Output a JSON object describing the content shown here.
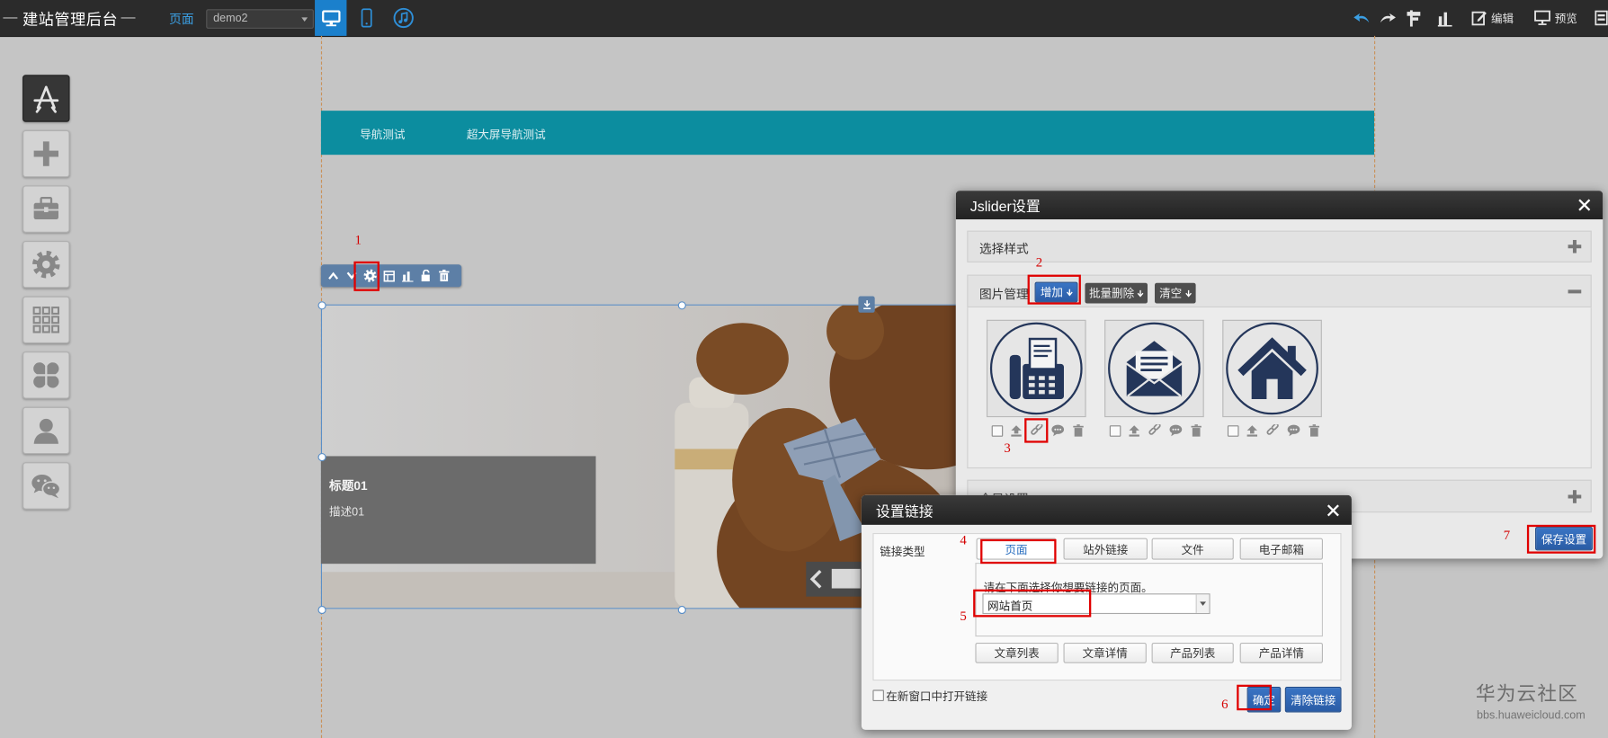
{
  "app": {
    "title": "建站管理后台"
  },
  "topbar": {
    "page_label": "页面",
    "page_select": "demo2",
    "edit_label": "编辑",
    "preview_label": "预览"
  },
  "left_toolbar": {
    "items": [
      {
        "icon": "app-store-icon"
      },
      {
        "icon": "plus-icon"
      },
      {
        "icon": "briefcase-icon"
      },
      {
        "icon": "gear-icon"
      },
      {
        "icon": "grid-icon"
      },
      {
        "icon": "clover-icon"
      },
      {
        "icon": "user-icon"
      },
      {
        "icon": "wechat-icon"
      }
    ]
  },
  "nav": {
    "items": [
      "导航测试",
      "超大屏导航测试"
    ]
  },
  "module_toolbar": {
    "icons": [
      "chevron-up-icon",
      "chevron-down-icon",
      "gear-icon",
      "layout-icon",
      "chart-icon",
      "unlock-icon",
      "trash-icon"
    ]
  },
  "slide": {
    "title": "标题01",
    "desc": "描述01"
  },
  "jslider": {
    "title": "Jslider设置",
    "sections": {
      "style": "选择样式",
      "images": "图片管理",
      "global": "全局设置"
    },
    "buttons": {
      "add": "增加",
      "batch_delete": "批量删除",
      "clear": "清空",
      "save": "保存设置"
    },
    "images": [
      {
        "icon": "fax-icon"
      },
      {
        "icon": "envelope-icon"
      },
      {
        "icon": "house-icon"
      }
    ]
  },
  "link_dialog": {
    "title": "设置链接",
    "type_label": "链接类型",
    "tabs": [
      "页面",
      "站外链接",
      "文件",
      "电子邮箱"
    ],
    "active_tab": "页面",
    "hint": "请在下面选择你想要链接的页面。",
    "page_select": "网站首页",
    "quick_buttons": [
      "文章列表",
      "文章详情",
      "产品列表",
      "产品详情"
    ],
    "new_window": "在新窗口中打开链接",
    "confirm": "确定",
    "clear": "清除链接"
  },
  "annotations": [
    "1",
    "2",
    "3",
    "4",
    "5",
    "6",
    "7"
  ],
  "watermark": {
    "name": "华为云社区",
    "url": "bbs.huaweicloud.com"
  },
  "colors": {
    "topbar": "#2b2b2b",
    "device_active": "#1b80cc",
    "nav": "#0c8d9f",
    "accent": "#2a5ca6",
    "highlight": "#e00000",
    "icon_navy": "#24365a"
  }
}
